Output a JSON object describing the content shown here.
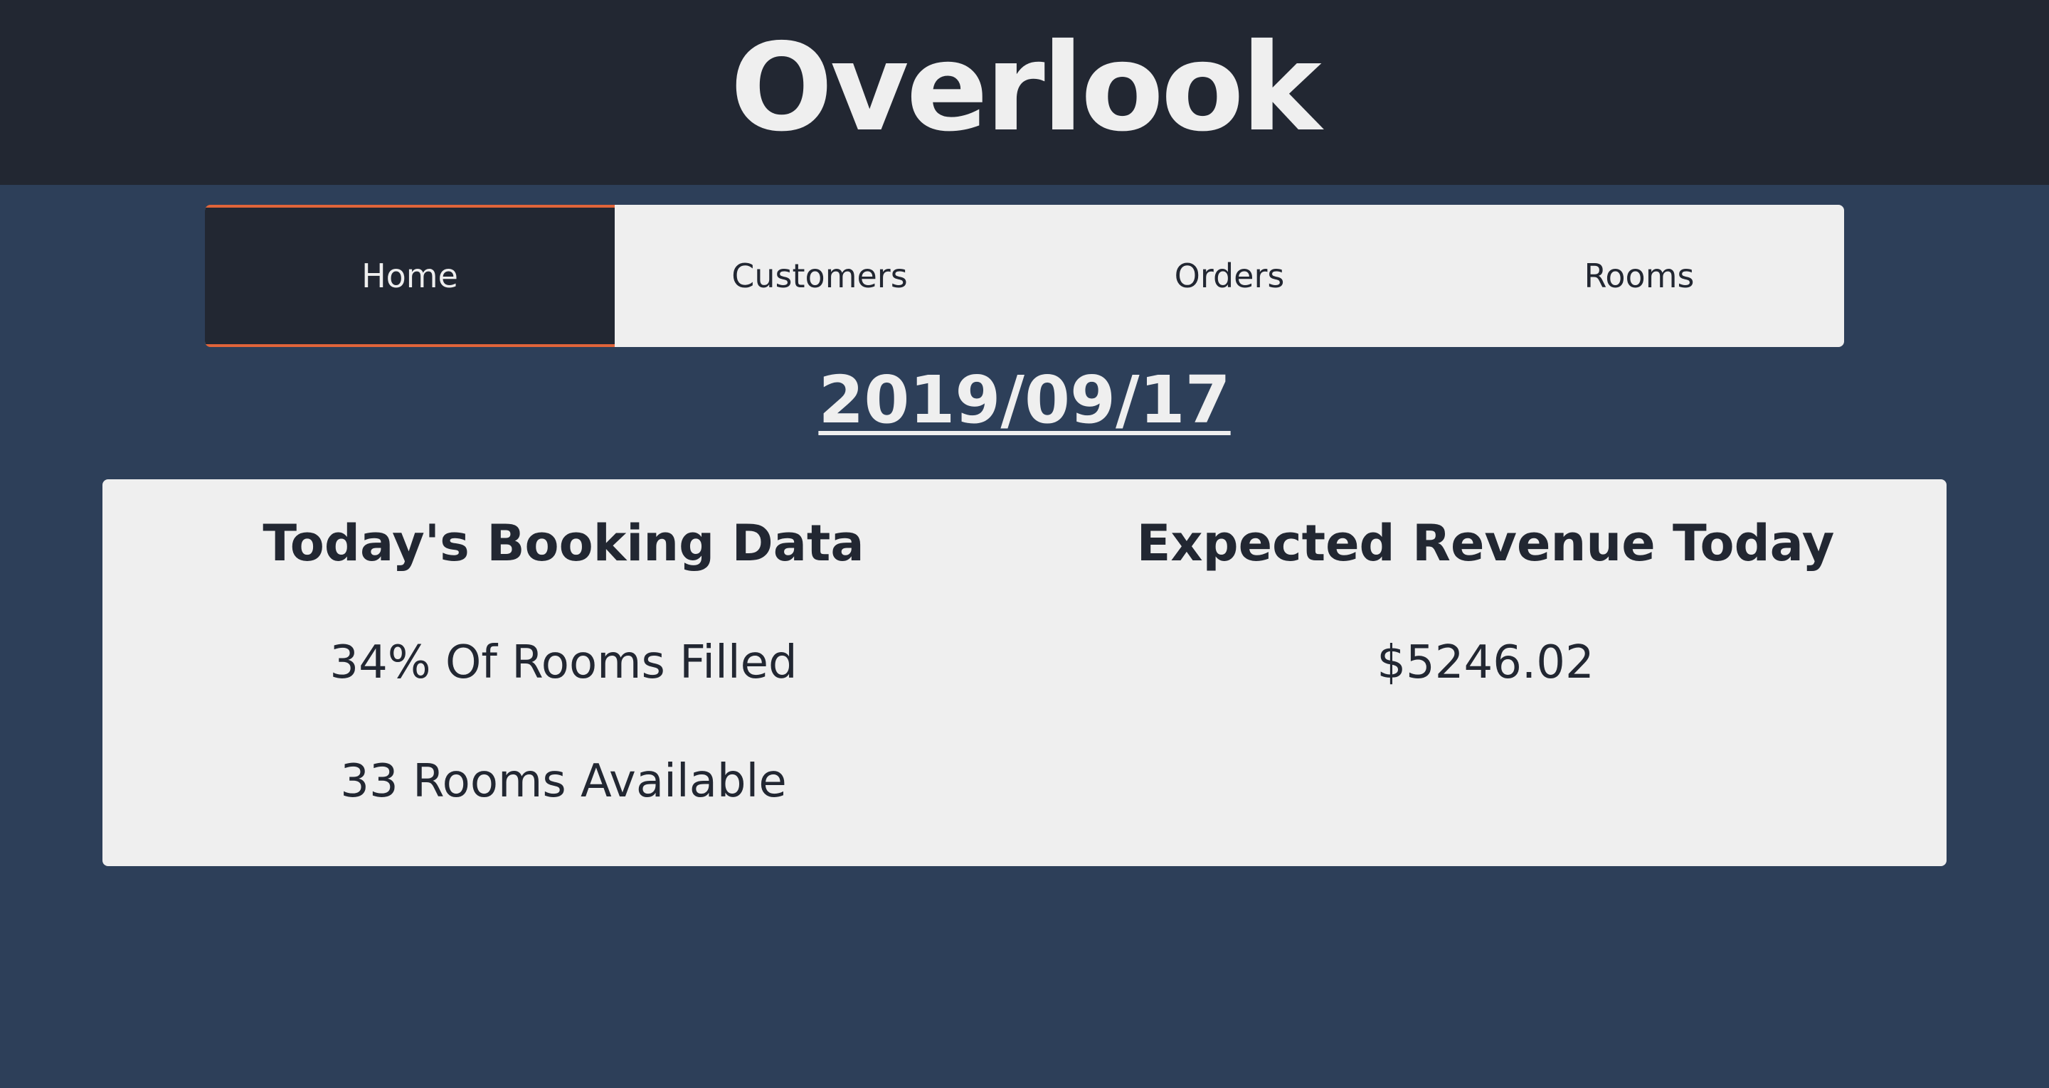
{
  "app": {
    "title": "Overlook"
  },
  "nav": {
    "tabs": [
      {
        "label": "Home",
        "active": true
      },
      {
        "label": "Customers",
        "active": false
      },
      {
        "label": "Orders",
        "active": false
      },
      {
        "label": "Rooms",
        "active": false
      }
    ]
  },
  "date": "2019/09/17",
  "booking": {
    "heading": "Today's Booking Data",
    "percent_filled": "34% Of Rooms Filled",
    "rooms_available": "33 Rooms Available"
  },
  "revenue": {
    "heading": "Expected Revenue Today",
    "amount": "$5246.02"
  },
  "colors": {
    "header_bg": "#222732",
    "page_bg": "#2d3f59",
    "panel_bg": "#efefef",
    "accent": "#e0643a",
    "text_dark": "#222732",
    "text_light": "#efefef"
  }
}
